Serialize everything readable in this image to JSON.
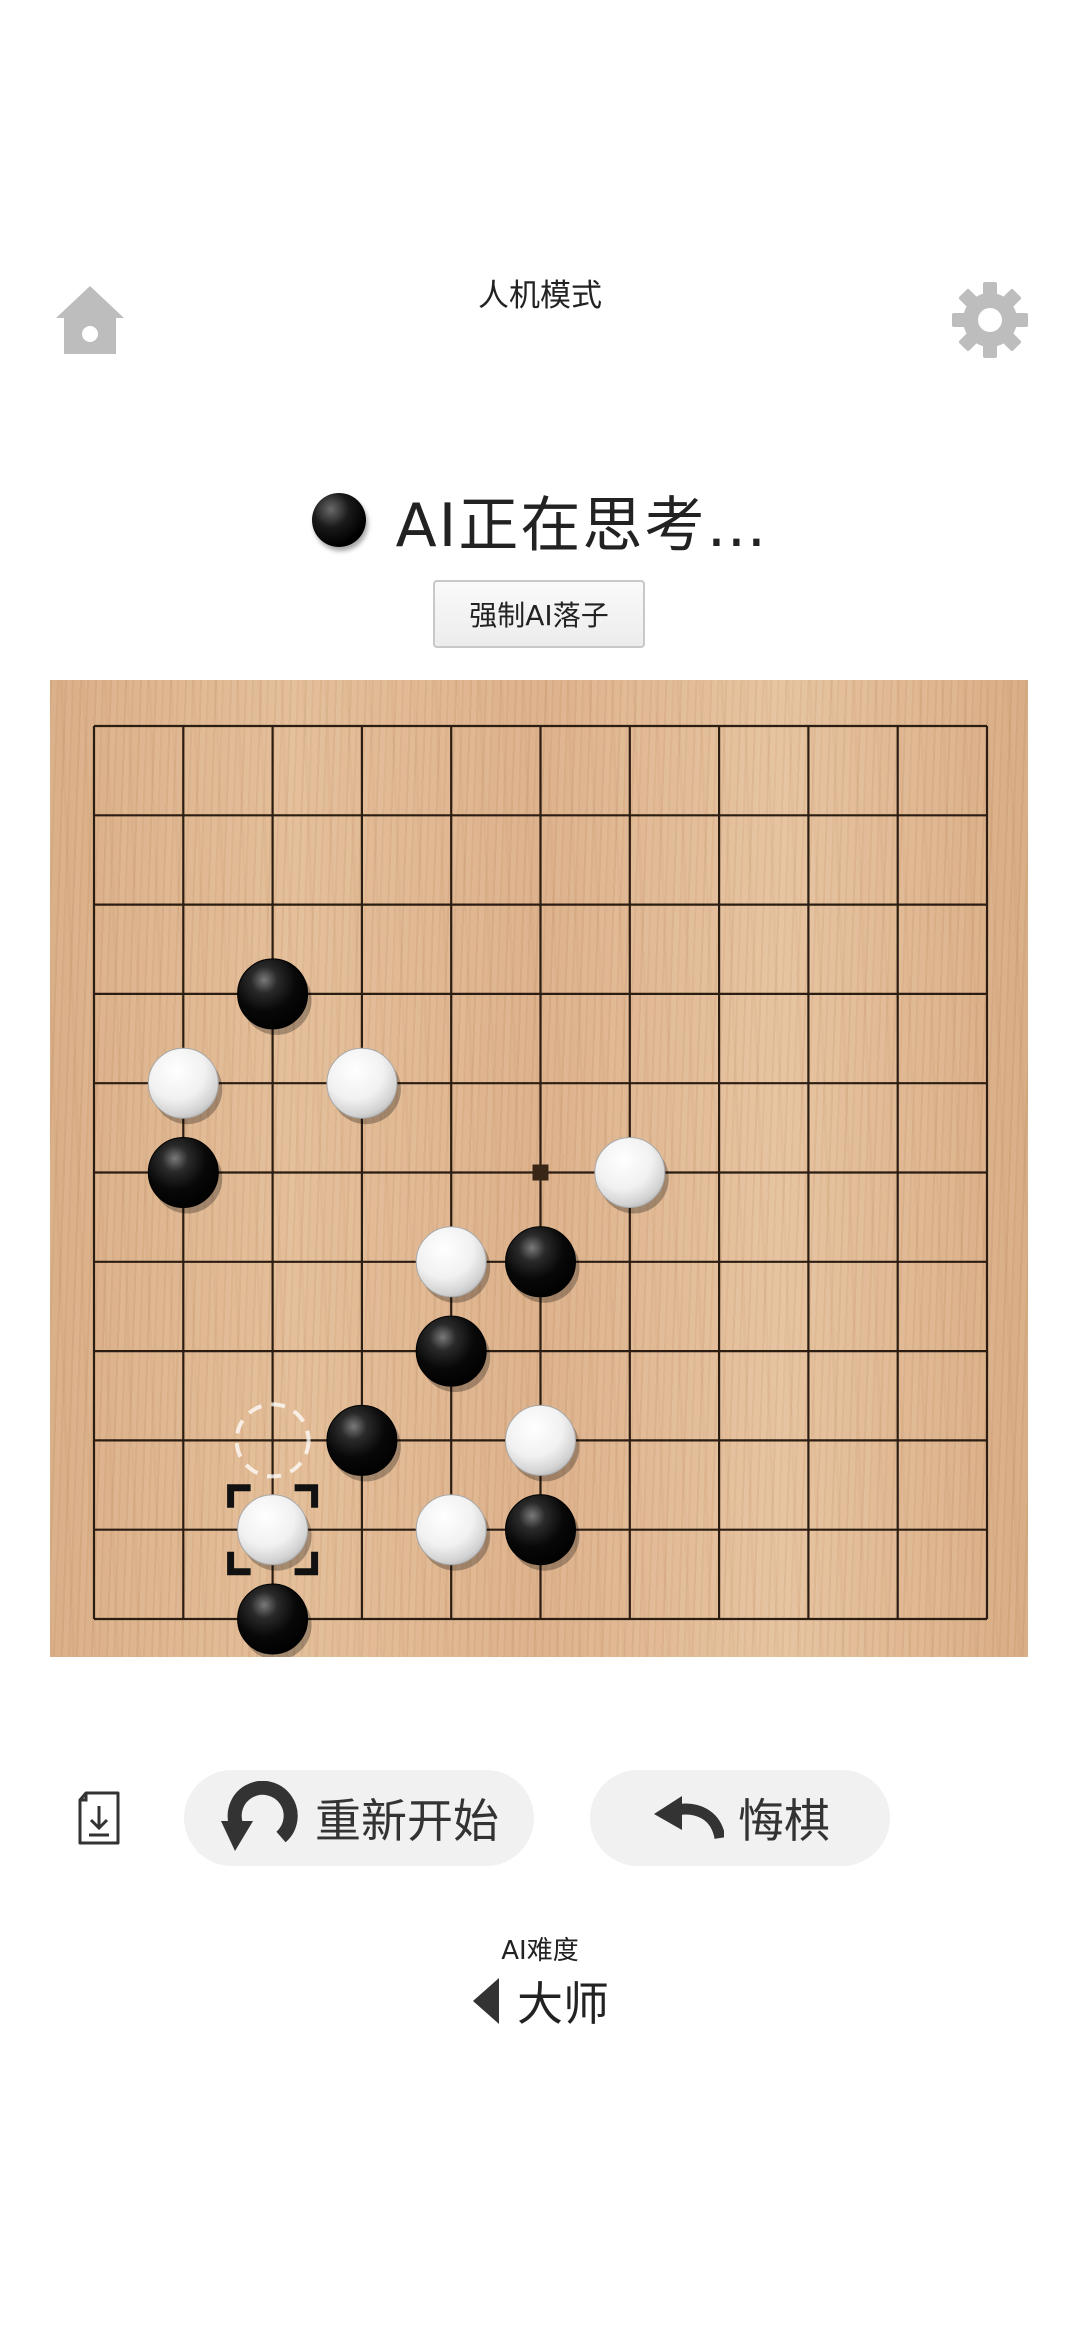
{
  "header": {
    "mode_title": "人机模式",
    "home_icon": "home-icon",
    "settings_icon": "gear-icon"
  },
  "status": {
    "turn_stone": "black",
    "text": "AI正在思考…",
    "force_button_label": "强制AI落子"
  },
  "board": {
    "size": 11,
    "star_point": [
      5,
      5
    ],
    "black_stones": [
      [
        3,
        2
      ],
      [
        5,
        1
      ],
      [
        6,
        5
      ],
      [
        7,
        4
      ],
      [
        8,
        3
      ],
      [
        9,
        5
      ],
      [
        10,
        2
      ]
    ],
    "white_stones": [
      [
        4,
        1
      ],
      [
        4,
        3
      ],
      [
        5,
        6
      ],
      [
        6,
        4
      ],
      [
        8,
        5
      ],
      [
        9,
        2
      ],
      [
        9,
        4
      ]
    ],
    "last_move": [
      9,
      2
    ],
    "hint_position": [
      8,
      2
    ],
    "colors": {
      "wood": "#e0b48c",
      "grid": "#2b1d12",
      "black": "#000000",
      "white": "#f4f4f4"
    }
  },
  "controls": {
    "save_icon": "save-record-icon",
    "restart_label": "重新开始",
    "restart_icon": "restart-icon",
    "undo_label": "悔棋",
    "undo_icon": "undo-icon"
  },
  "difficulty": {
    "caption": "AI难度",
    "value": "大师",
    "prev_icon": "chevron-left-icon"
  }
}
